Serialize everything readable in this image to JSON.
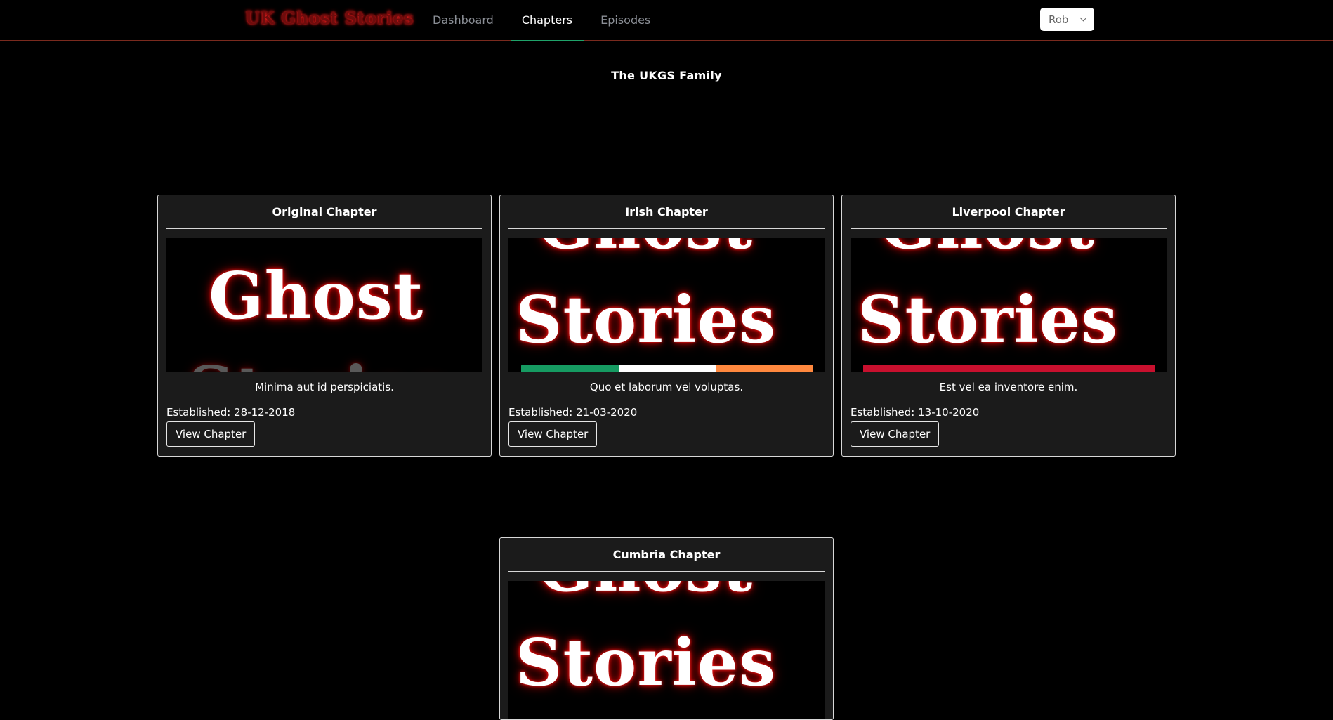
{
  "nav": {
    "brand": "UK Ghost Stories",
    "links": [
      {
        "label": "Dashboard",
        "active": false
      },
      {
        "label": "Chapters",
        "active": true
      },
      {
        "label": "Episodes",
        "active": false
      }
    ],
    "user": "Rob"
  },
  "page": {
    "title": "The UKGS Family"
  },
  "chapters": [
    {
      "title": "Original Chapter",
      "image_text": [
        "Ghost",
        "Stories"
      ],
      "description": "Minima aut id perspiciatis.",
      "established": "Established: 28-12-2018",
      "button": "View Chapter"
    },
    {
      "title": "Irish Chapter",
      "image_text": [
        "Ghost",
        "Stories"
      ],
      "flag_colors": [
        "#169b62",
        "#ffffff",
        "#ff883e"
      ],
      "description": "Quo et laborum vel voluptas.",
      "established": "Established: 21-03-2020",
      "button": "View Chapter"
    },
    {
      "title": "Liverpool Chapter",
      "image_text": [
        "Ghost",
        "Stories"
      ],
      "flag_colors": [
        "#c8102e"
      ],
      "description": "Est vel ea inventore enim.",
      "established": "Established: 13-10-2020",
      "button": "View Chapter"
    },
    {
      "title": "Cumbria Chapter",
      "image_text": [
        "Ghost",
        "Stories"
      ]
    }
  ],
  "colors": {
    "accent_tab": "#1fa36a",
    "nav_border": "#7a2a1e",
    "card_bg": "#1b1b1b",
    "glow_red": "#c40000"
  }
}
